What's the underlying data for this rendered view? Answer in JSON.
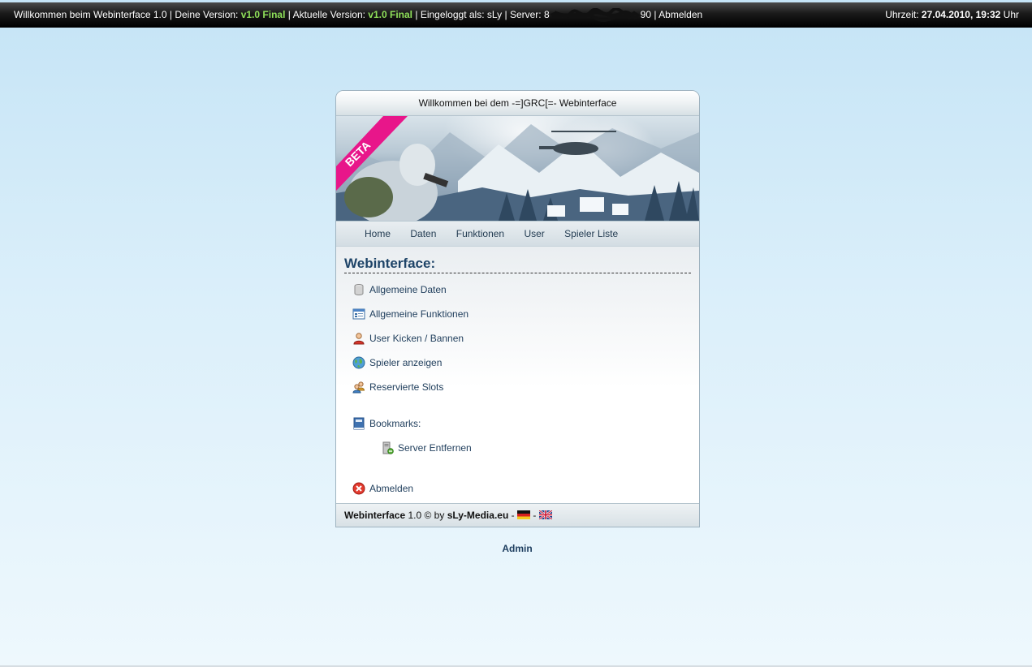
{
  "topbar": {
    "welcome": "Willkommen beim Webinterface 1.0",
    "your_version_label": "Deine Version:",
    "your_version": "v1.0 Final",
    "current_version_label": "Aktuelle Version:",
    "current_version": "v1.0 Final",
    "logged_in_label": "Eingeloggt als:",
    "user": "sLy",
    "server_label": "Server:",
    "server_prefix": "8",
    "server_suffix": "90",
    "logout": "Abmelden",
    "time_label": "Uhrzeit:",
    "time_value": "27.04.2010, 19:32",
    "time_unit": "Uhr",
    "separator": "|"
  },
  "panel": {
    "title": "Willkommen bei dem -=]GRC[=- Webinterface",
    "banner_ribbon": "BETA"
  },
  "nav": {
    "items": [
      "Home",
      "Daten",
      "Funktionen",
      "User",
      "Spieler Liste"
    ]
  },
  "content": {
    "title": "Webinterface:",
    "items": [
      {
        "label": "Allgemeine Daten",
        "icon": "database-icon"
      },
      {
        "label": "Allgemeine Funktionen",
        "icon": "window-list-icon"
      },
      {
        "label": "User Kicken / Bannen",
        "icon": "user-icon"
      },
      {
        "label": "Spieler anzeigen",
        "icon": "globe-icon"
      },
      {
        "label": "Reservierte Slots",
        "icon": "users-icon"
      }
    ],
    "bookmarks": {
      "label": "Bookmarks:",
      "icon": "book-icon"
    },
    "bookmark_items": [
      {
        "label": "Server Entfernen",
        "icon": "server-remove-icon"
      }
    ],
    "logout": {
      "label": "Abmelden",
      "icon": "close-circle-icon"
    }
  },
  "footer": {
    "app_name": "Webinterface",
    "version_copy": "1.0 © by",
    "site": "sLy-Media.eu",
    "dash1": "-",
    "dash2": "-"
  },
  "admin_link": "Admin",
  "colors": {
    "accent_green": "#8fe05a",
    "link_blue": "#22405e",
    "title_blue": "#1e4468",
    "ribbon_pink": "#e8168a"
  }
}
